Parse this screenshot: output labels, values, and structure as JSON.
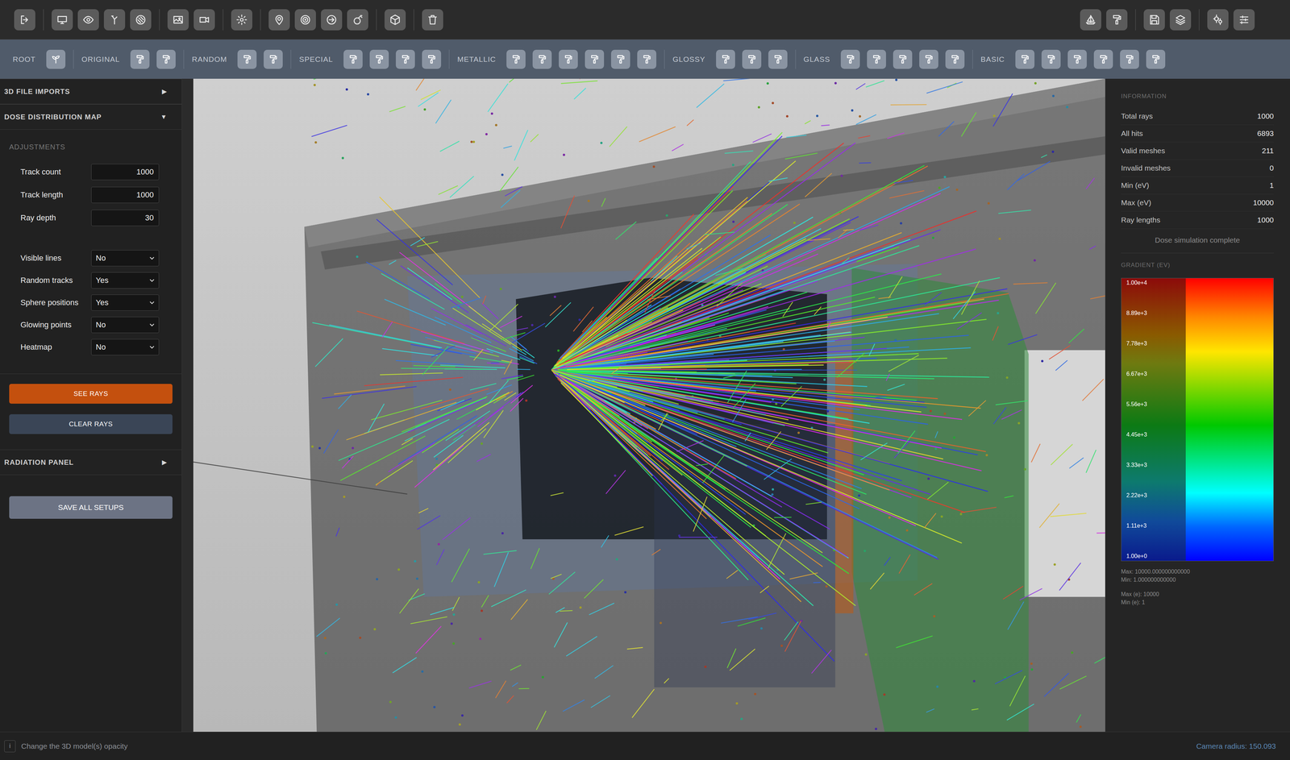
{
  "material_bar": {
    "groups": [
      {
        "label": "ROOT"
      },
      {
        "label": "ORIGINAL"
      },
      {
        "label": "RANDOM"
      },
      {
        "label": "SPECIAL"
      },
      {
        "label": "METALLIC"
      },
      {
        "label": "GLOSSY"
      },
      {
        "label": "GLASS"
      },
      {
        "label": "BASIC"
      }
    ]
  },
  "sidebar": {
    "sections": [
      {
        "title": "3D FILE IMPORTS",
        "toggle": "▶",
        "expanded": false
      },
      {
        "title": "DOSE DISTRIBUTION MAP",
        "toggle": "▼",
        "expanded": true
      },
      {
        "title": "RADIATION PANEL",
        "toggle": "▶",
        "expanded": false
      }
    ],
    "adjustments": {
      "title": "ADJUSTMENTS",
      "fields": [
        {
          "label": "Track count",
          "value": "1000"
        },
        {
          "label": "Track length",
          "value": "1000"
        },
        {
          "label": "Ray depth",
          "value": "30"
        }
      ],
      "selects": [
        {
          "label": "Visible lines",
          "value": "No"
        },
        {
          "label": "Random tracks",
          "value": "Yes"
        },
        {
          "label": "Sphere positions",
          "value": "Yes"
        },
        {
          "label": "Glowing points",
          "value": "No"
        },
        {
          "label": "Heatmap",
          "value": "No"
        }
      ],
      "buttons": [
        {
          "label": "SEE RAYS",
          "kind": "primary"
        },
        {
          "label": "CLEAR RAYS",
          "kind": "secondary"
        }
      ]
    },
    "save_button": "SAVE ALL SETUPS"
  },
  "information": {
    "title": "INFORMATION",
    "rows": [
      {
        "label": "Total rays",
        "value": "1000"
      },
      {
        "label": "All hits",
        "value": "6893"
      },
      {
        "label": "Valid meshes",
        "value": "211"
      },
      {
        "label": "Invalid meshes",
        "value": "0"
      },
      {
        "label": "Min (eV)",
        "value": "1"
      },
      {
        "label": "Max (eV)",
        "value": "10000"
      },
      {
        "label": "Ray lengths",
        "value": "1000"
      }
    ],
    "status": "Dose simulation complete"
  },
  "gradient": {
    "title": "GRADIENT (EV)",
    "ticks": [
      "1.00e+4",
      "8.89e+3",
      "7.78e+3",
      "6.67e+3",
      "5.56e+3",
      "4.45e+3",
      "3.33e+3",
      "2.22e+3",
      "1.11e+3",
      "1.00e+0"
    ],
    "range": [
      "Max: 10000.000000000000",
      "Min: 1.000000000000"
    ],
    "range_e": [
      "Max (e): 10000",
      "Min (e): 1"
    ]
  },
  "status_bar": {
    "info_icon": "i",
    "hint": "Change the 3D model(s) opacity",
    "camera": "Camera radius: 150.093"
  }
}
